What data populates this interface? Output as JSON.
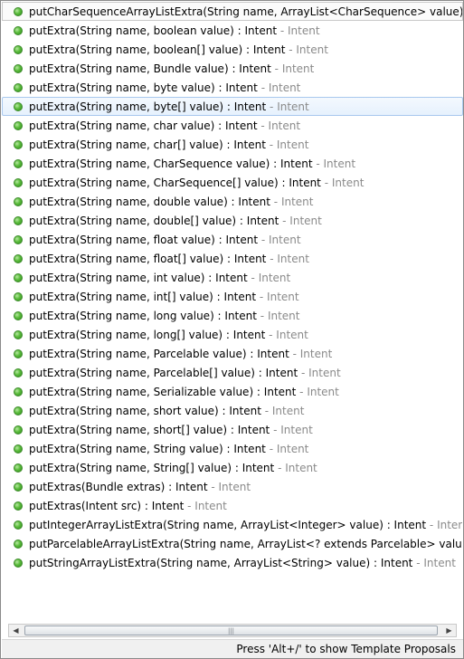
{
  "proposals": [
    {
      "signature": "putCharSequenceArrayListExtra(String name, ArrayList<CharSequence> value) : Intent",
      "owner": "",
      "icon": "public-method-icon"
    },
    {
      "signature": "putExtra(String name, boolean value) : Intent",
      "owner": "Intent",
      "icon": "public-method-icon"
    },
    {
      "signature": "putExtra(String name, boolean[] value) : Intent",
      "owner": "Intent",
      "icon": "public-method-icon"
    },
    {
      "signature": "putExtra(String name, Bundle value) : Intent",
      "owner": "Intent",
      "icon": "public-method-icon"
    },
    {
      "signature": "putExtra(String name, byte value) : Intent",
      "owner": "Intent",
      "icon": "public-method-icon"
    },
    {
      "signature": "putExtra(String name, byte[] value) : Intent",
      "owner": "Intent",
      "icon": "public-method-icon"
    },
    {
      "signature": "putExtra(String name, char value) : Intent",
      "owner": "Intent",
      "icon": "public-method-icon"
    },
    {
      "signature": "putExtra(String name, char[] value) : Intent",
      "owner": "Intent",
      "icon": "public-method-icon"
    },
    {
      "signature": "putExtra(String name, CharSequence value) : Intent",
      "owner": "Intent",
      "icon": "public-method-icon"
    },
    {
      "signature": "putExtra(String name, CharSequence[] value) : Intent",
      "owner": "Intent",
      "icon": "public-method-icon"
    },
    {
      "signature": "putExtra(String name, double value) : Intent",
      "owner": "Intent",
      "icon": "public-method-icon"
    },
    {
      "signature": "putExtra(String name, double[] value) : Intent",
      "owner": "Intent",
      "icon": "public-method-icon"
    },
    {
      "signature": "putExtra(String name, float value) : Intent",
      "owner": "Intent",
      "icon": "public-method-icon"
    },
    {
      "signature": "putExtra(String name, float[] value) : Intent",
      "owner": "Intent",
      "icon": "public-method-icon"
    },
    {
      "signature": "putExtra(String name, int value) : Intent",
      "owner": "Intent",
      "icon": "public-method-icon"
    },
    {
      "signature": "putExtra(String name, int[] value) : Intent",
      "owner": "Intent",
      "icon": "public-method-icon"
    },
    {
      "signature": "putExtra(String name, long value) : Intent",
      "owner": "Intent",
      "icon": "public-method-icon"
    },
    {
      "signature": "putExtra(String name, long[] value) : Intent",
      "owner": "Intent",
      "icon": "public-method-icon"
    },
    {
      "signature": "putExtra(String name, Parcelable value) : Intent",
      "owner": "Intent",
      "icon": "public-method-icon"
    },
    {
      "signature": "putExtra(String name, Parcelable[] value) : Intent",
      "owner": "Intent",
      "icon": "public-method-icon"
    },
    {
      "signature": "putExtra(String name, Serializable value) : Intent",
      "owner": "Intent",
      "icon": "public-method-icon"
    },
    {
      "signature": "putExtra(String name, short value) : Intent",
      "owner": "Intent",
      "icon": "public-method-icon"
    },
    {
      "signature": "putExtra(String name, short[] value) : Intent",
      "owner": "Intent",
      "icon": "public-method-icon"
    },
    {
      "signature": "putExtra(String name, String value) : Intent",
      "owner": "Intent",
      "icon": "public-method-icon"
    },
    {
      "signature": "putExtra(String name, String[] value) : Intent",
      "owner": "Intent",
      "icon": "public-method-icon"
    },
    {
      "signature": "putExtras(Bundle extras) : Intent",
      "owner": "Intent",
      "icon": "public-method-icon"
    },
    {
      "signature": "putExtras(Intent src) : Intent",
      "owner": "Intent",
      "icon": "public-method-icon"
    },
    {
      "signature": "putIntegerArrayListExtra(String name, ArrayList<Integer> value) : Intent",
      "owner": "Intent",
      "icon": "public-method-icon"
    },
    {
      "signature": "putParcelableArrayListExtra(String name, ArrayList<? extends Parcelable> value) : Intent",
      "owner": "",
      "icon": "public-method-icon"
    },
    {
      "signature": "putStringArrayListExtra(String name, ArrayList<String> value) : Intent",
      "owner": "Intent",
      "icon": "public-method-icon"
    }
  ],
  "selected_index": 5,
  "separator": " - ",
  "scrollbar": {
    "left_arrow": "◀",
    "right_arrow": "▶",
    "grip": "|||"
  },
  "status_text": "Press 'Alt+/' to show Template Proposals",
  "colors": {
    "owner_text": "#8a8a8a",
    "selection_border": "#a8c8ee",
    "method_icon": "#5bbd3c"
  }
}
